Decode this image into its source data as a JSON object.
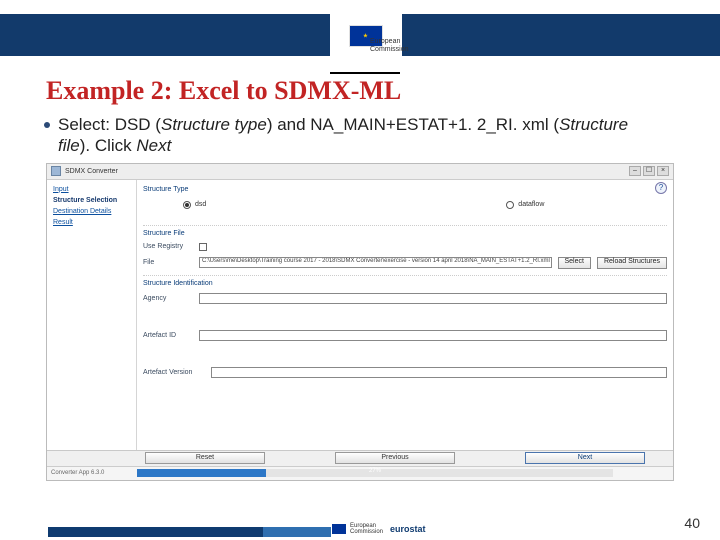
{
  "header": {
    "commission_line1": "European",
    "commission_line2": "Commission"
  },
  "slide": {
    "title": "Example 2: Excel to SDMX-ML",
    "bullet_prefix": "Select: DSD (",
    "bullet_i1": "Structure type",
    "bullet_mid": ") and NA_MAIN+ESTAT+1. 2_RI. xml (",
    "bullet_i2": "Structure file",
    "bullet_suffix": "). Click ",
    "bullet_i3": "Next",
    "number": "40"
  },
  "app": {
    "window_title": "SDMX Converter",
    "window_min": "–",
    "window_max": "☐",
    "window_close": "×",
    "help_symbol": "?",
    "sidebar": {
      "items": [
        {
          "label": "Input"
        },
        {
          "label": "Structure Selection"
        },
        {
          "label": "Destination Details"
        },
        {
          "label": "Result"
        }
      ]
    },
    "structure_type": {
      "label": "Structure Type",
      "options": [
        {
          "label": "dsd",
          "checked": true
        },
        {
          "label": "dataflow",
          "checked": false
        }
      ]
    },
    "structure_file": {
      "group": "Structure File",
      "use_registry_label": "Use Registry",
      "file_label": "File",
      "file_value": "C:\\Users\\me\\Desktop\\Training course 2017 - 2018\\SDMX Converter\\exercise - version 14 april 2018\\NA_MAIN_ESTAT+1.2_RI.xml",
      "select_btn": "Select",
      "reload_btn": "Reload Structures"
    },
    "identification": {
      "group": "Structure Identification",
      "agency_label": "Agency",
      "agency_value": "",
      "artefact_label": "Artefact ID",
      "artefact_value": "",
      "version_label": "Artefact Version",
      "version_value": ""
    },
    "nav": {
      "reset": "Reset",
      "previous": "Previous",
      "next": "Next"
    },
    "status": {
      "app_version": "Converter App 6.3.0",
      "progress_pct": "27%"
    }
  },
  "footer": {
    "commission_line1": "European",
    "commission_line2": "Commission",
    "eurostat": "eurostat"
  }
}
